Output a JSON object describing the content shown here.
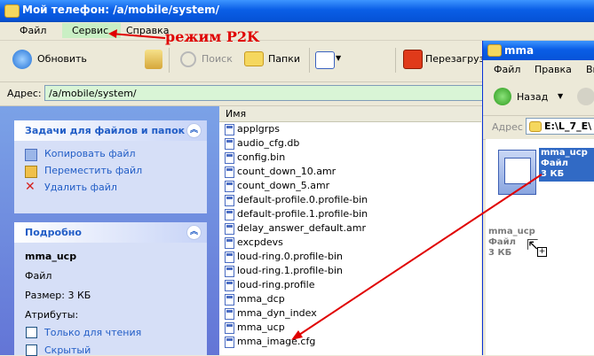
{
  "window": {
    "title": "Мой телефон: /a/mobile/system/"
  },
  "menu": {
    "file": "Файл",
    "service": "Сервис",
    "help": "Справка"
  },
  "annotation": {
    "text": "режим P2K"
  },
  "toolbar": {
    "refresh": "Обновить",
    "search": "Поиск",
    "folders": "Папки",
    "reboot": "Перезагруз"
  },
  "address": {
    "label": "Адрес:",
    "value": "/a/mobile/system/"
  },
  "tasks": {
    "title": "Задачи для файлов и папок",
    "items": [
      "Копировать файл",
      "Переместить файл",
      "Удалить файл"
    ]
  },
  "details": {
    "title": "Подробно",
    "name": "mma_ucp",
    "type": "Файл",
    "size": "Размер: 3 КБ",
    "attrs": "Атрибуты:",
    "readonly": "Только для чтения",
    "hidden": "Скрытый"
  },
  "filelist": {
    "column": "Имя",
    "files": [
      "applgrps",
      "audio_cfg.db",
      "config.bin",
      "count_down_10.amr",
      "count_down_5.amr",
      "default-profile.0.profile-bin",
      "default-profile.1.profile-bin",
      "delay_answer_default.amr",
      "excpdevs",
      "loud-ring.0.profile-bin",
      "loud-ring.1.profile-bin",
      "loud-ring.profile",
      "mma_dcp",
      "mma_dyn_index",
      "mma_ucp",
      "mma_image.cfg"
    ]
  },
  "rightwin": {
    "title": "mma",
    "menu": {
      "file": "Файл",
      "edit": "Правка",
      "view": "Ви"
    },
    "back": "Назад",
    "addr_label": "Адрес",
    "addr_value": "E:\\L_7_E\\",
    "selected": {
      "name": "mma_ucp",
      "type": "Файл",
      "size": "3 КБ"
    },
    "ghost": {
      "name": "mma_ucp",
      "type": "Файл",
      "size": "3 КБ"
    }
  },
  "colors": {
    "annotation": "#e00000",
    "highlight": "#c9efc4",
    "xp_blue": "#0a5ee6"
  }
}
